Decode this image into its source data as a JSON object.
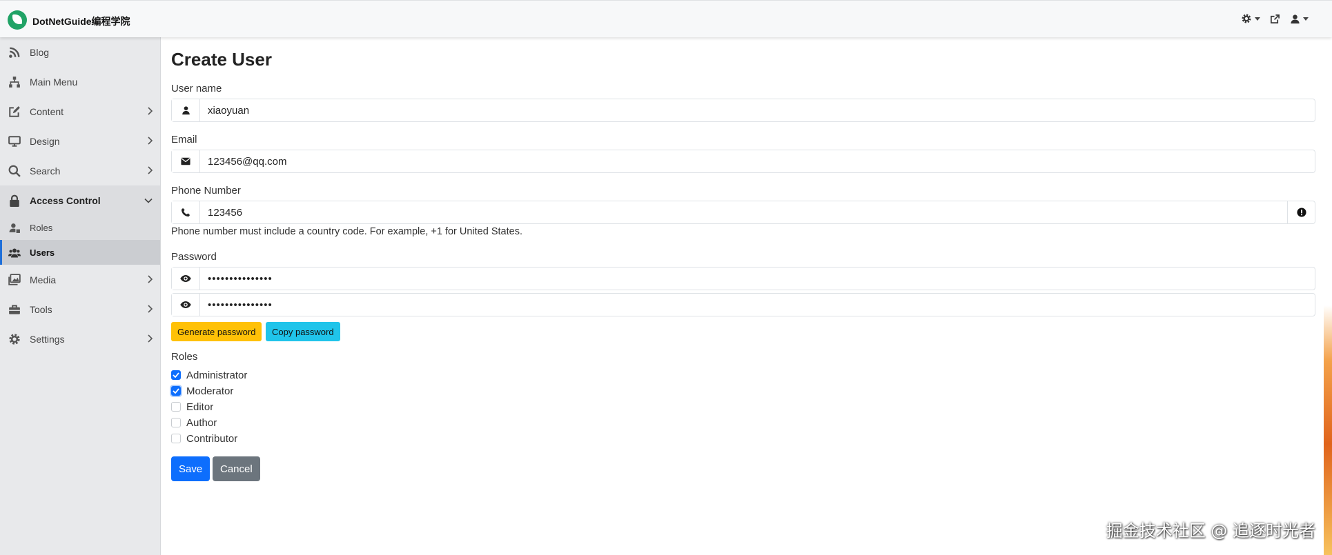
{
  "app": {
    "brand": "DotNetGuide编程学院"
  },
  "topbar": {
    "icons": [
      "gear-icon",
      "external-link-icon",
      "user-icon"
    ]
  },
  "sidebar": {
    "items": [
      {
        "label": "Blog",
        "icon": "rss-icon"
      },
      {
        "label": "Main Menu",
        "icon": "sitemap-icon"
      },
      {
        "label": "Content",
        "icon": "edit-icon",
        "has_children": true
      },
      {
        "label": "Design",
        "icon": "monitor-icon",
        "has_children": true
      },
      {
        "label": "Search",
        "icon": "search-icon",
        "has_children": true
      },
      {
        "label": "Access Control",
        "icon": "lock-icon",
        "expanded": true
      },
      {
        "label": "Media",
        "icon": "images-icon",
        "has_children": true
      },
      {
        "label": "Tools",
        "icon": "toolbox-icon",
        "has_children": true
      },
      {
        "label": "Settings",
        "icon": "cog-icon",
        "has_children": true
      }
    ],
    "subitems": [
      {
        "label": "Roles",
        "icon": "user-tag-icon"
      },
      {
        "label": "Users",
        "icon": "users-icon",
        "active": true
      }
    ]
  },
  "form": {
    "title": "Create User",
    "username_label": "User name",
    "username_value": "xiaoyuan",
    "email_label": "Email",
    "email_value": "123456@qq.com",
    "phone_label": "Phone Number",
    "phone_value": "123456",
    "phone_hint": "Phone number must include a country code. For example, +1 for United States.",
    "password_label": "Password",
    "password_value": "•••••••••••••••",
    "password_confirm_value": "•••••••••••••••",
    "generate_label": "Generate password",
    "copy_label": "Copy password",
    "roles_label": "Roles",
    "roles": [
      {
        "name": "Administrator",
        "checked": true
      },
      {
        "name": "Moderator",
        "checked": true
      },
      {
        "name": "Editor",
        "checked": false
      },
      {
        "name": "Author",
        "checked": false
      },
      {
        "name": "Contributor",
        "checked": false
      }
    ],
    "save_label": "Save",
    "cancel_label": "Cancel"
  },
  "watermark": "掘金技术社区 @ 追逐时光者",
  "colors": {
    "primary": "#0d6efd",
    "secondary": "#6c757d",
    "warning": "#ffc107",
    "info": "#20c4ea",
    "sidebar_bg": "#e8e9eb",
    "brand_green": "#21a366"
  }
}
